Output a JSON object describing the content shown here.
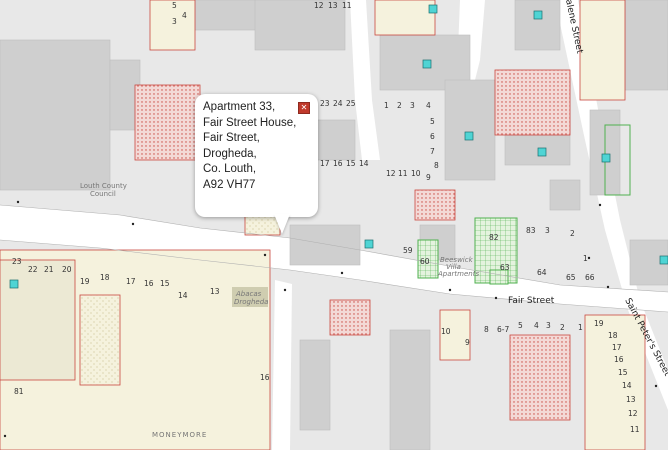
{
  "popup": {
    "address_lines": [
      "Apartment 33,",
      "Fair Street House,",
      "Fair Street,",
      "Drogheda,",
      "Co. Louth,",
      "A92 VH77"
    ],
    "close_glyph": "✕",
    "close_icon": "close-icon"
  },
  "streets": {
    "fair_street": "Fair Street",
    "saint_peters_street": "Saint Peter's Street",
    "magdalene_street": "alene Street"
  },
  "places": {
    "louth_council": [
      "Louth County",
      "Council"
    ],
    "abacas": [
      "Abacas",
      "Drogheda"
    ],
    "beeswick": [
      "Beeswick",
      "Villa",
      "Apartments"
    ],
    "moneymore": "MONEYMORE"
  },
  "house_numbers": {
    "top_row": [
      "12",
      "13",
      "11"
    ],
    "row_24": [
      "23",
      "24",
      "25"
    ],
    "row_16": [
      "17",
      "16",
      "15",
      "14"
    ],
    "row_12": [
      "12",
      "11",
      "10",
      "9"
    ],
    "col_1_4": [
      "1",
      "2",
      "3",
      "4"
    ],
    "col_5_8": [
      "5",
      "6",
      "7",
      "8"
    ],
    "left_block": [
      "23",
      "22",
      "21",
      "20",
      "19",
      "18",
      "17",
      "16",
      "15",
      "14",
      "13"
    ],
    "right_block": [
      "10",
      "9",
      "8",
      "6-7",
      "5",
      "4",
      "3",
      "2",
      "1"
    ],
    "fair_right": [
      "59",
      "60",
      "63",
      "64",
      "65",
      "66",
      "83",
      "82",
      "1",
      "2",
      "3"
    ],
    "fs_side": [
      "19",
      "18",
      "17",
      "16",
      "15",
      "14",
      "13",
      "12",
      "11"
    ],
    "misc": [
      "5",
      "3",
      "4",
      "16",
      "81"
    ]
  },
  "colors": {
    "road": "#ffffff",
    "building": "#cfcfcf",
    "parcel_red": "#c9473f",
    "parcel_fill": "#f5f2dd",
    "green": "#4fb04f",
    "marker": "#4fd4d4"
  },
  "markers": {
    "icon": "marker-square-icon",
    "count": 10
  }
}
